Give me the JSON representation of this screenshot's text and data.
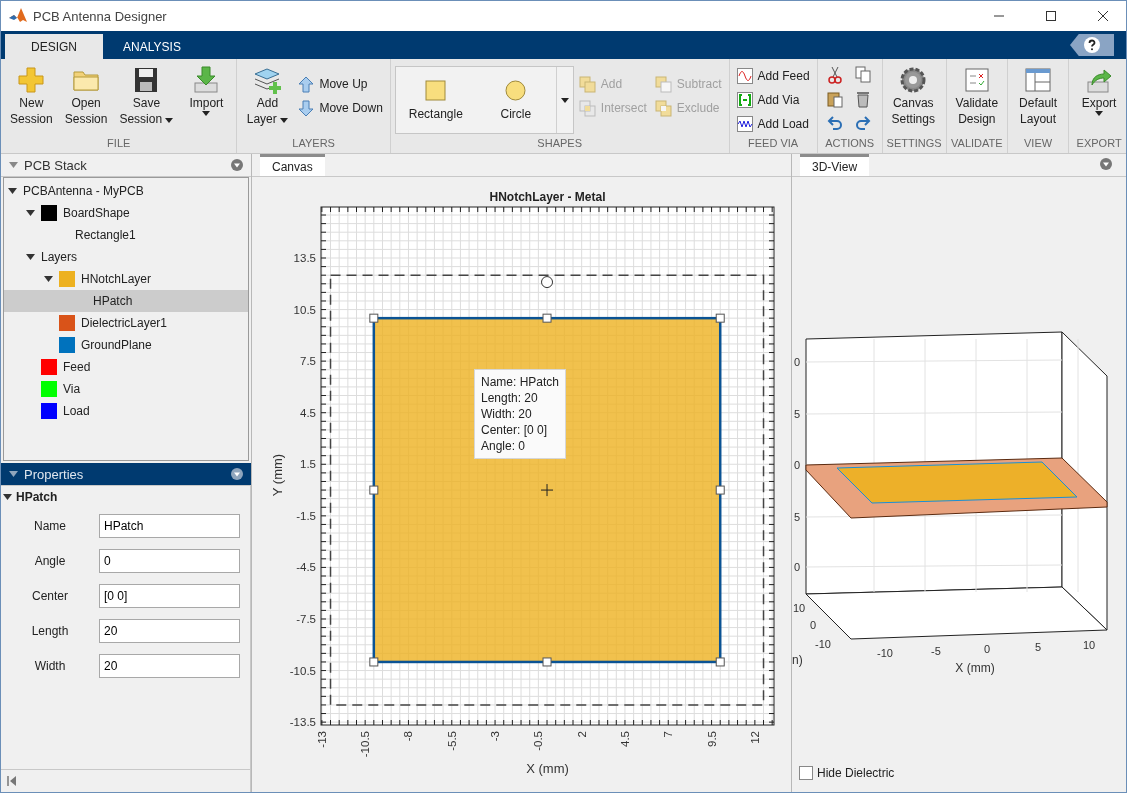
{
  "window": {
    "title": "PCB Antenna Designer"
  },
  "tabs": [
    {
      "label": "DESIGN",
      "selected": true
    },
    {
      "label": "ANALYSIS",
      "selected": false
    }
  ],
  "ribbon": [
    {
      "label": "FILE",
      "items": [
        {
          "kind": "large",
          "lines": [
            "New",
            "Session"
          ],
          "menu": false
        },
        {
          "kind": "large",
          "lines": [
            "Open",
            "Session"
          ],
          "menu": false
        },
        {
          "kind": "large",
          "lines": [
            "Save",
            "Session"
          ],
          "menu": true
        },
        {
          "kind": "large",
          "lines": [
            "Import"
          ],
          "menu": true
        }
      ]
    },
    {
      "label": "LAYERS",
      "items": [
        {
          "kind": "large",
          "lines": [
            "Add",
            "Layer"
          ],
          "menu": true
        },
        {
          "kind": "small",
          "label": "Move Up",
          "disabled": false
        },
        {
          "kind": "small",
          "label": "Move Down",
          "disabled": false
        }
      ]
    },
    {
      "label": "SHAPES",
      "items": [
        {
          "kind": "gallery",
          "options": [
            "Rectangle",
            "Circle"
          ]
        },
        {
          "kind": "small",
          "label": "Add",
          "disabled": true
        },
        {
          "kind": "small",
          "label": "Intersect",
          "disabled": true
        },
        {
          "kind": "small",
          "label": "Subtract",
          "disabled": true
        },
        {
          "kind": "small",
          "label": "Exclude",
          "disabled": true
        }
      ]
    },
    {
      "label": "FEED VIA",
      "items": [
        {
          "kind": "small",
          "label": "Add Feed",
          "disabled": false
        },
        {
          "kind": "small",
          "label": "Add Via",
          "disabled": false
        },
        {
          "kind": "small",
          "label": "Add Load",
          "disabled": false
        }
      ]
    },
    {
      "label": "ACTIONS",
      "items": [
        {
          "kind": "icon"
        },
        {
          "kind": "icon"
        },
        {
          "kind": "icon"
        },
        {
          "kind": "icon"
        },
        {
          "kind": "icon"
        },
        {
          "kind": "icon"
        }
      ]
    },
    {
      "label": "SETTINGS",
      "items": [
        {
          "kind": "large",
          "lines": [
            "Canvas",
            "Settings"
          ],
          "menu": false
        }
      ]
    },
    {
      "label": "VALIDATE",
      "items": [
        {
          "kind": "large",
          "lines": [
            "Validate",
            "Design"
          ],
          "menu": false
        }
      ]
    },
    {
      "label": "VIEW",
      "items": [
        {
          "kind": "large",
          "lines": [
            "Default",
            "Layout"
          ],
          "menu": false
        }
      ]
    },
    {
      "label": "EXPORT",
      "items": [
        {
          "kind": "large",
          "lines": [
            "Export"
          ],
          "menu": true
        }
      ]
    }
  ],
  "pcb_stack": {
    "title": "PCB Stack",
    "tree": [
      {
        "label": "PCBAntenna - MyPCB",
        "expanded": true,
        "selected": false,
        "children": [
          {
            "label": "BoardShape",
            "color": "#000000",
            "expanded": true,
            "selected": false,
            "children": [
              {
                "label": "Rectangle1",
                "selected": false
              }
            ]
          },
          {
            "label": "Layers",
            "expanded": true,
            "selected": false,
            "children": [
              {
                "label": "HNotchLayer",
                "color": "#edb120",
                "expanded": true,
                "selected": false,
                "children": [
                  {
                    "label": "HPatch",
                    "selected": true
                  }
                ]
              },
              {
                "label": "DielectricLayer1",
                "color": "#d95319",
                "selected": false
              },
              {
                "label": "GroundPlane",
                "color": "#0072bd",
                "selected": false
              }
            ]
          },
          {
            "label": "Feed",
            "color": "#ff0000",
            "selected": false
          },
          {
            "label": "Via",
            "color": "#00ff00",
            "selected": false
          },
          {
            "label": "Load",
            "color": "#0000ff",
            "selected": false
          }
        ]
      }
    ]
  },
  "properties": {
    "title": "Properties",
    "object": "HPatch",
    "fields": [
      {
        "label": "Name",
        "value": "HPatch"
      },
      {
        "label": "Angle",
        "value": "0"
      },
      {
        "label": "Center",
        "value": "[0 0]"
      },
      {
        "label": "Length",
        "value": "20"
      },
      {
        "label": "Width",
        "value": "20"
      }
    ]
  },
  "canvas": {
    "tab": "Canvas",
    "title": "HNotchLayer - Metal",
    "xlabel": "X (mm)",
    "ylabel": "Y (mm)",
    "xticks": [
      "-13",
      "-10.5",
      "-8",
      "-5.5",
      "-3",
      "-0.5",
      "2",
      "4.5",
      "7",
      "9.5",
      "12"
    ],
    "yticks": [
      "13.5",
      "10.5",
      "7.5",
      "4.5",
      "1.5",
      "-1.5",
      "-4.5",
      "-7.5",
      "-10.5",
      "-13.5"
    ],
    "tooltip": [
      "Name: HPatch",
      "Length: 20",
      "Width: 20",
      "Center: [0 0]",
      "Angle: 0"
    ]
  },
  "view3d": {
    "tab": "3D-View",
    "zticks": [
      "0",
      "5",
      "0",
      "5",
      "0"
    ],
    "yticks": [
      "10",
      "0",
      "-10"
    ],
    "ylabel": "n)",
    "xticks": [
      "-10",
      "-5",
      "0",
      "5",
      "10"
    ],
    "xlabel": "X (mm)",
    "hide_dielectric": {
      "label": "Hide Dielectric",
      "checked": false
    }
  }
}
